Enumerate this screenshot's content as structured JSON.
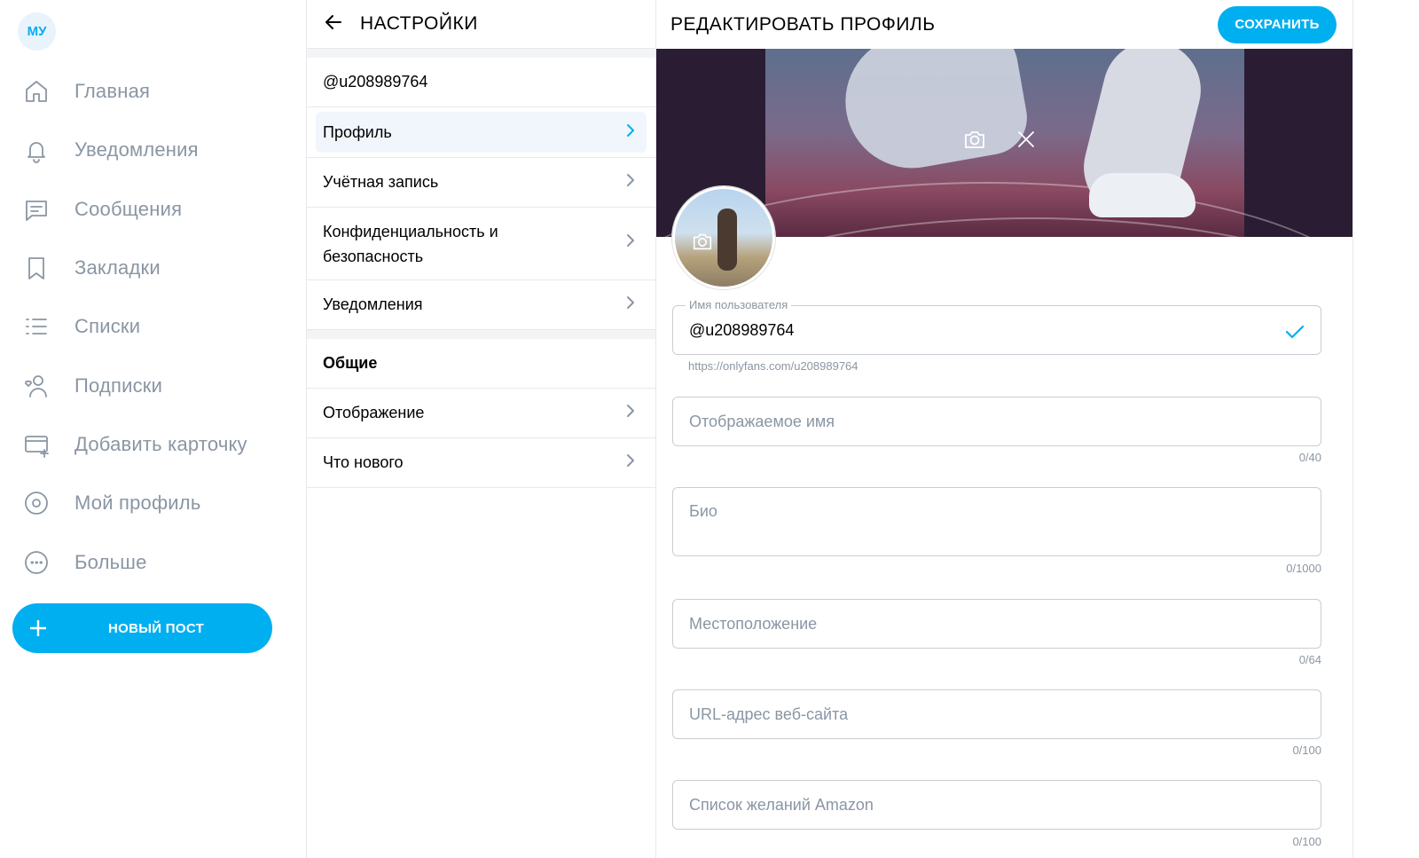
{
  "nav": {
    "avatar_initials": "МУ",
    "items": [
      {
        "label": "Главная",
        "icon": "home-icon"
      },
      {
        "label": "Уведомления",
        "icon": "bell-icon"
      },
      {
        "label": "Сообщения",
        "icon": "message-icon"
      },
      {
        "label": "Закладки",
        "icon": "bookmark-icon"
      },
      {
        "label": "Списки",
        "icon": "list-icon"
      },
      {
        "label": "Подписки",
        "icon": "subscriptions-icon"
      },
      {
        "label": "Добавить карточку",
        "icon": "add-card-icon"
      },
      {
        "label": "Мой профиль",
        "icon": "profile-icon"
      },
      {
        "label": "Больше",
        "icon": "more-icon"
      }
    ],
    "new_post_label": "НОВЫЙ ПОСТ"
  },
  "settings": {
    "title": "НАСТРОЙКИ",
    "username": "@u208989764",
    "items": [
      {
        "label": "Профиль",
        "active": true
      },
      {
        "label": "Учётная запись"
      },
      {
        "label": "Конфиденциальность и безопасность"
      },
      {
        "label": "Уведомления"
      }
    ],
    "section_general": "Общие",
    "general_items": [
      {
        "label": "Отображение"
      },
      {
        "label": "Что нового"
      }
    ]
  },
  "edit_profile": {
    "title": "РЕДАКТИРОВАТЬ ПРОФИЛЬ",
    "save_label": "СОХРАНИТЬ",
    "username_label": "Имя пользователя",
    "username_value": "@u208989764",
    "profile_url": "https://onlyfans.com/u208989764",
    "display_name_placeholder": "Отображаемое имя",
    "display_name_counter": "0/40",
    "bio_placeholder": "Био",
    "bio_counter": "0/1000",
    "location_placeholder": "Местоположение",
    "location_counter": "0/64",
    "website_placeholder": "URL-адрес веб-сайта",
    "website_counter": "0/100",
    "amazon_placeholder": "Список желаний Amazon",
    "amazon_counter": "0/100"
  },
  "colors": {
    "accent": "#00aff0",
    "muted": "#8a96a3",
    "active_row_bg": "#f1f6fc"
  }
}
